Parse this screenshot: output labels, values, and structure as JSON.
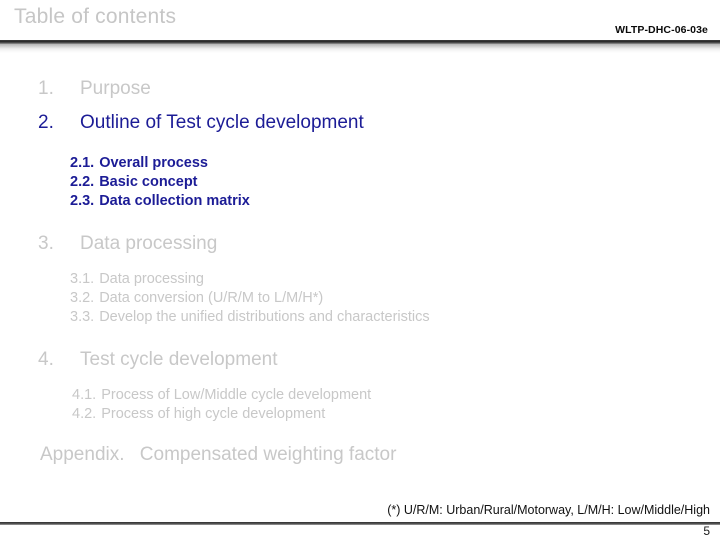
{
  "header": {
    "title": "Table of contents",
    "doc_code": "WLTP-DHC-06-03e"
  },
  "toc": {
    "items": [
      {
        "num": "1.",
        "label": "Purpose",
        "state": "inactive"
      },
      {
        "num": "2.",
        "label": "Outline of Test cycle development",
        "state": "active"
      },
      {
        "num": "2.1.",
        "label": "Overall process",
        "state": "active"
      },
      {
        "num": "2.2.",
        "label": "Basic concept",
        "state": "active"
      },
      {
        "num": "2.3.",
        "label": "Data collection matrix",
        "state": "active"
      },
      {
        "num": "3.",
        "label": "Data processing",
        "state": "inactive"
      },
      {
        "num": "3.1.",
        "label": "Data processing",
        "state": "inactive"
      },
      {
        "num": "3.2.",
        "label": "Data conversion (U/R/M to L/M/H*)",
        "state": "inactive"
      },
      {
        "num": "3.3.",
        "label": "Develop the unified distributions and characteristics",
        "state": "inactive"
      },
      {
        "num": "4.",
        "label": "Test cycle development",
        "state": "inactive"
      },
      {
        "num": "4.1.",
        "label": "Process of Low/Middle cycle development",
        "state": "inactive"
      },
      {
        "num": "4.2.",
        "label": "Process of high cycle development",
        "state": "inactive"
      }
    ],
    "appendix": {
      "num": "Appendix.",
      "label": "Compensated weighting factor"
    }
  },
  "footer": {
    "footnote": "(*) U/R/M: Urban/Rural/Motorway, L/M/H: Low/Middle/High",
    "page_number": "5"
  },
  "colors": {
    "active": "#1c1c96",
    "inactive": "#c8c8c8",
    "title": "#c6c6c6",
    "doc_code": "#0a0a0a"
  }
}
